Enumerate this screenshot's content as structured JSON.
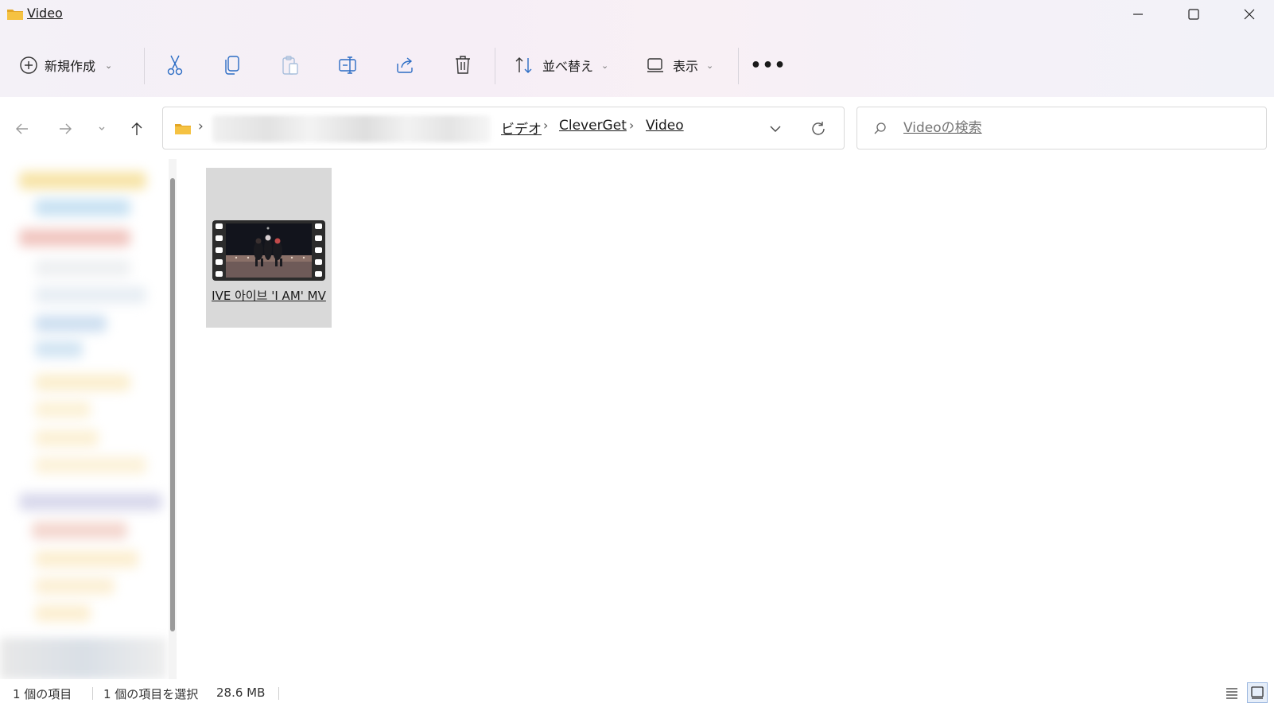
{
  "window": {
    "title": "Video",
    "minimize_icon": "minimize-icon",
    "maximize_icon": "maximize-icon",
    "close_icon": "close-icon"
  },
  "toolbar": {
    "new_label": "新規作成",
    "sort_label": "並べ替え",
    "view_label": "表示",
    "more_label": "•••",
    "icons": [
      "plus-circle-icon",
      "cut-icon",
      "copy-icon",
      "paste-icon",
      "rename-icon",
      "share-icon",
      "delete-icon",
      "sort-icon",
      "view-icon"
    ]
  },
  "navigation": {
    "breadcrumb": [
      "ビデオ",
      "CleverGet",
      "Video"
    ],
    "separator": "›"
  },
  "search": {
    "placeholder": "Videoの検索"
  },
  "files": [
    {
      "name": "IVE 아이브 'I AM' MV",
      "type": "video",
      "selected": true
    }
  ],
  "status": {
    "item_count": "1 個の項目",
    "selection": "1 個の項目を選択",
    "size": "28.6 MB"
  },
  "colors": {
    "folder_yellow": "#f5c242",
    "folder_dark": "#e3a626",
    "selected_item_bg": "#d9d9d9",
    "accent_blue": "#2b6cc4"
  }
}
